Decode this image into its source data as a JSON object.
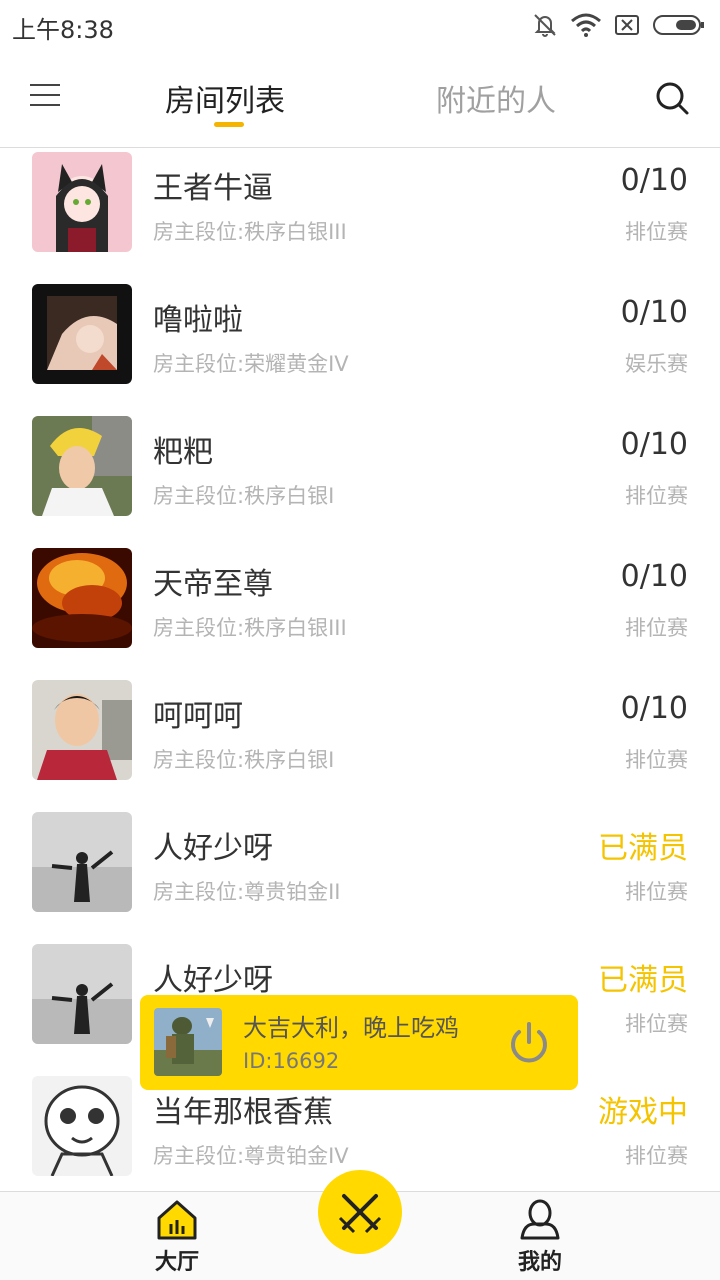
{
  "status_bar": {
    "time": "上午8:38",
    "icons": [
      "bell-muted-icon",
      "wifi-icon",
      "sim-x-icon",
      "battery-icon"
    ]
  },
  "header": {
    "menu_icon": "menu-icon",
    "tabs": [
      {
        "label": "房间列表",
        "active": true
      },
      {
        "label": "附近的人",
        "active": false
      }
    ],
    "search_icon": "search-icon"
  },
  "rooms": [
    {
      "name": "王者牛逼",
      "rank": "房主段位:秩序白银III",
      "count": "0/10",
      "type": "排位赛",
      "full": false
    },
    {
      "name": "噜啦啦",
      "rank": "房主段位:荣耀黄金IV",
      "count": "0/10",
      "type": "娱乐赛",
      "full": false
    },
    {
      "name": "粑粑",
      "rank": "房主段位:秩序白银I",
      "count": "0/10",
      "type": "排位赛",
      "full": false
    },
    {
      "name": "天帝至尊",
      "rank": "房主段位:秩序白银III",
      "count": "0/10",
      "type": "排位赛",
      "full": false
    },
    {
      "name": "呵呵呵",
      "rank": "房主段位:秩序白银I",
      "count": "0/10",
      "type": "排位赛",
      "full": false
    },
    {
      "name": "人好少呀",
      "rank": "房主段位:尊贵铂金II",
      "count": "已满员",
      "type": "排位赛",
      "full": true
    },
    {
      "name": "人好少呀",
      "rank": "",
      "count": "已满员",
      "type": "排位赛",
      "full": true
    },
    {
      "name": "当年那根香蕉",
      "rank": "房主段位:尊贵铂金IV",
      "count": "游戏中",
      "type": "排位赛",
      "full": true
    }
  ],
  "floating_card": {
    "title": "大吉大利，晚上吃鸡",
    "id": "ID:16692",
    "icon": "power-icon"
  },
  "bottom_nav": {
    "items": [
      {
        "label": "大厅",
        "icon": "home-icon"
      },
      {
        "label": "我的",
        "icon": "user-icon"
      }
    ],
    "center_icon": "crossed-swords-icon"
  },
  "colors": {
    "accent": "#ffd900",
    "tab_indicator": "#f5b400",
    "full_text": "#f5c400"
  }
}
